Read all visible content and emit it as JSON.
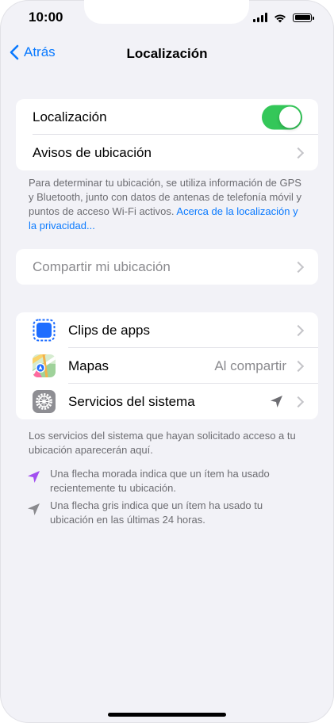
{
  "status_bar": {
    "time": "10:00"
  },
  "nav": {
    "back_label": "Atrás",
    "title": "Localización"
  },
  "section1": {
    "location_label": "Localización",
    "location_enabled": true,
    "alerts_label": "Avisos de ubicación"
  },
  "footer1": {
    "text": "Para determinar tu ubicación, se utiliza información de GPS y Bluetooth, junto con datos de antenas de telefonía móvil y puntos de acceso Wi-Fi activos. ",
    "link": "Acerca de la localización y la privacidad..."
  },
  "share": {
    "label": "Compartir mi ubicación"
  },
  "apps": {
    "items": [
      {
        "label": "Clips de apps",
        "value": ""
      },
      {
        "label": "Mapas",
        "value": "Al compartir"
      },
      {
        "label": "Servicios del sistema",
        "value": ""
      }
    ]
  },
  "footer2": {
    "text": "Los servicios del sistema que hayan solicitado acceso a tu ubicación aparecerán aquí.",
    "legend_purple": "Una flecha morada indica que un ítem ha usado recientemente tu ubicación.",
    "legend_gray": "Una flecha gris indica que un ítem ha usado tu ubicación en las últimas 24 horas."
  },
  "colors": {
    "accent": "#0a7aff",
    "toggle_on": "#34c759",
    "purple_arrow": "#a24ff0",
    "gray_arrow": "#8a8a8e"
  }
}
